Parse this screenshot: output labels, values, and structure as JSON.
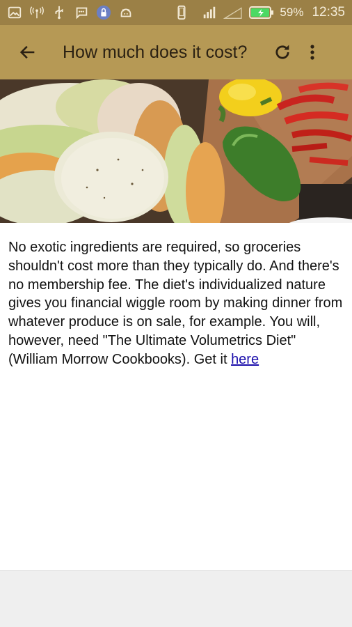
{
  "status_bar": {
    "battery_percent": "59%",
    "time": "12:35",
    "icons": [
      "image-icon",
      "signal-tower-icon",
      "usb-icon",
      "chat-icon",
      "lock-icon",
      "android-icon",
      "phone-icon",
      "signal-icon",
      "no-signal-icon",
      "battery-icon"
    ]
  },
  "app_bar": {
    "title": "How much does it cost?",
    "back_icon": "arrow-back-icon",
    "refresh_icon": "refresh-icon",
    "more_icon": "more-vert-icon"
  },
  "article": {
    "body": "No exotic ingredients are required, so groceries shouldn't cost more than they typically do. And there's no membership fee. The diet's individualized nature gives you financial wiggle room by making dinner from whatever produce is on sale, for example. You will, however, need \"The Ultimate Volumetrics Diet\" (William Morrow Cookbooks). Get it ",
    "link_text": "here"
  },
  "colors": {
    "status_bar": "#9b8046",
    "app_bar": "#b69955",
    "link": "#1a0dab"
  }
}
